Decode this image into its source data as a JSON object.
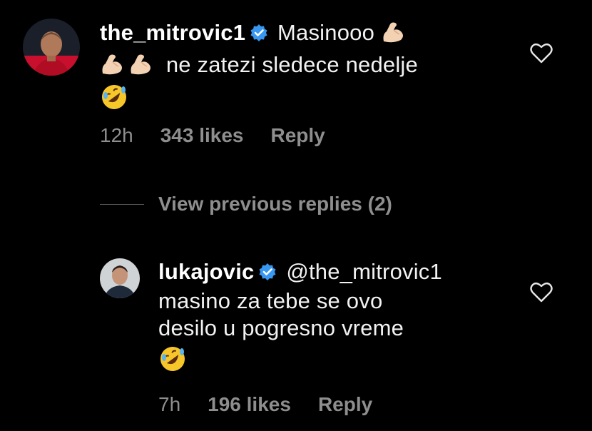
{
  "comment": {
    "username": "the_mitrovic1",
    "text_1": "Masinooo",
    "text_2": "ne zatezi sledece nedelje",
    "time": "12h",
    "likes": "343 likes",
    "reply": "Reply"
  },
  "view_previous": {
    "label": "View previous replies (2)"
  },
  "reply_comment": {
    "username": "lukajovic",
    "mention": "@the_mitrovic1",
    "line_2": "masino za tebe se ovo",
    "line_3": "desilo u pogresno vreme",
    "time": "7h",
    "likes": "196 likes",
    "reply": "Reply"
  },
  "icons": {
    "verified": "verified-badge-icon",
    "like": "heart-outline-icon",
    "flexed_biceps": "flexed-biceps-emoji",
    "rofl": "rolling-on-floor-laughing-emoji"
  },
  "colors": {
    "background": "#000000",
    "text": "#f2f2f2",
    "muted": "#8e8e8e",
    "verified_blue": "#3897f0"
  }
}
